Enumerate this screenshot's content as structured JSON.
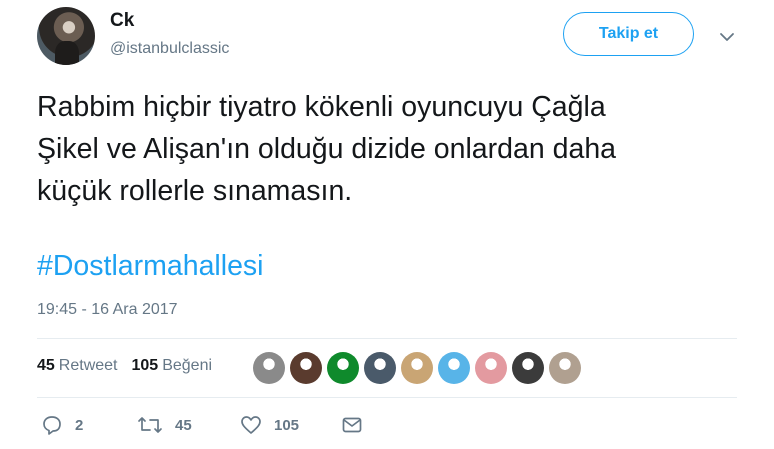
{
  "author": {
    "display_name": "Ck",
    "username": "@istanbulclassic"
  },
  "follow_button_label": "Takip et",
  "tweet": {
    "lines": [
      "Rabbim hiçbir tiyatro kökenli oyuncuyu Çağla",
      "Şikel ve Alişan'ın olduğu dizide onlardan daha",
      "küçük rollerle sınamasın."
    ],
    "hashtag": "#Dostlarmahallesi",
    "timestamp": "19:45 - 16 Ara 2017"
  },
  "stats": {
    "retweet_count": "45",
    "retweet_label": "Retweet",
    "like_count": "105",
    "like_label": "Beğeni"
  },
  "likers": [
    {
      "name": "liker-avatar-1",
      "color": "#8a8a8a"
    },
    {
      "name": "liker-avatar-2",
      "color": "#5a3b2e"
    },
    {
      "name": "liker-avatar-3",
      "color": "#0f8a2c"
    },
    {
      "name": "liker-avatar-4",
      "color": "#4a5a6a"
    },
    {
      "name": "liker-avatar-5",
      "color": "#c9a574"
    },
    {
      "name": "liker-avatar-6",
      "color": "#58b4e8"
    },
    {
      "name": "liker-avatar-7",
      "color": "#e39aa0"
    },
    {
      "name": "liker-avatar-8",
      "color": "#3b3b3b"
    },
    {
      "name": "liker-avatar-9",
      "color": "#b0a090"
    }
  ],
  "actions": {
    "reply_count": "2",
    "retweet_count": "45",
    "like_count": "105"
  },
  "colors": {
    "accent": "#1da1f2",
    "secondary_text": "#657786",
    "divider": "#e6ecf0"
  }
}
